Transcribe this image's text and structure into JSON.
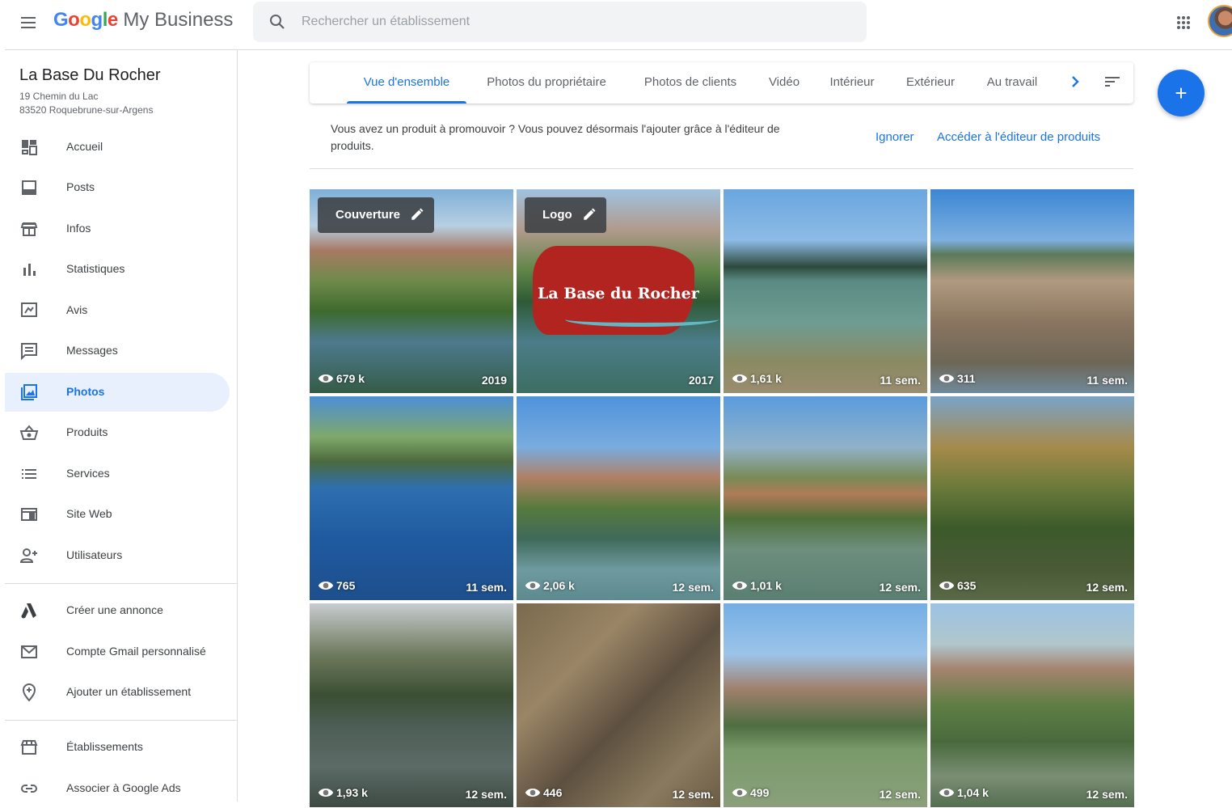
{
  "app": {
    "brand_google": "Google",
    "brand_rest": " My Business"
  },
  "search": {
    "placeholder": "Rechercher un établissement"
  },
  "business": {
    "name": "La Base Du Rocher",
    "address_line1": "19 Chemin du Lac",
    "address_line2": "83520 Roquebrune-sur-Argens"
  },
  "sidebar": {
    "items": [
      {
        "label": "Accueil",
        "icon": "dashboard-icon"
      },
      {
        "label": "Posts",
        "icon": "posts-icon"
      },
      {
        "label": "Infos",
        "icon": "storefront-icon"
      },
      {
        "label": "Statistiques",
        "icon": "bar-chart-icon"
      },
      {
        "label": "Avis",
        "icon": "reviews-icon"
      },
      {
        "label": "Messages",
        "icon": "messages-icon"
      },
      {
        "label": "Photos",
        "icon": "photos-icon",
        "active": true
      },
      {
        "label": "Produits",
        "icon": "basket-icon"
      },
      {
        "label": "Services",
        "icon": "list-icon"
      },
      {
        "label": "Site Web",
        "icon": "website-icon"
      },
      {
        "label": "Utilisateurs",
        "icon": "add-user-icon"
      }
    ],
    "secondary": [
      {
        "label": "Créer une annonce",
        "icon": "google-ads-icon"
      },
      {
        "label": "Compte Gmail personnalisé",
        "icon": "gmail-icon"
      },
      {
        "label": "Ajouter un établissement",
        "icon": "add-location-icon"
      }
    ],
    "tertiary": [
      {
        "label": "Établissements",
        "icon": "stores-icon"
      },
      {
        "label": "Associer à Google Ads",
        "icon": "link-icon"
      }
    ]
  },
  "tabs": [
    {
      "label": "Vue d'ensemble",
      "active": true
    },
    {
      "label": "Photos du propriétaire"
    },
    {
      "label": "Photos de clients"
    },
    {
      "label": "Vidéo"
    },
    {
      "label": "Intérieur"
    },
    {
      "label": "Extérieur"
    },
    {
      "label": "Au travail"
    }
  ],
  "promo": {
    "text": "Vous avez un produit à promouvoir ? Vous pouvez désormais l'ajouter grâce à l'éditeur de produits.",
    "ignore": "Ignorer",
    "editor": "Accéder à l'éditeur de produits"
  },
  "fab": {
    "label": "+"
  },
  "photos": [
    {
      "views": "679 k",
      "age": "2019",
      "tag": "Couverture"
    },
    {
      "views": "",
      "age": "2017",
      "tag": "Logo",
      "logo_text": "La Base du Rocher"
    },
    {
      "views": "1,61 k",
      "age": "11 sem."
    },
    {
      "views": "311",
      "age": "11 sem."
    },
    {
      "views": "765",
      "age": "11 sem."
    },
    {
      "views": "2,06 k",
      "age": "12 sem."
    },
    {
      "views": "1,01 k",
      "age": "12 sem."
    },
    {
      "views": "635",
      "age": "12 sem."
    },
    {
      "views": "1,93 k",
      "age": "12 sem."
    },
    {
      "views": "446",
      "age": "12 sem."
    },
    {
      "views": "499",
      "age": "12 sem."
    },
    {
      "views": "1,04 k",
      "age": "12 sem."
    }
  ],
  "colors": {
    "accent": "#1a73e8",
    "active_nav_bg": "#e8f0fe"
  }
}
